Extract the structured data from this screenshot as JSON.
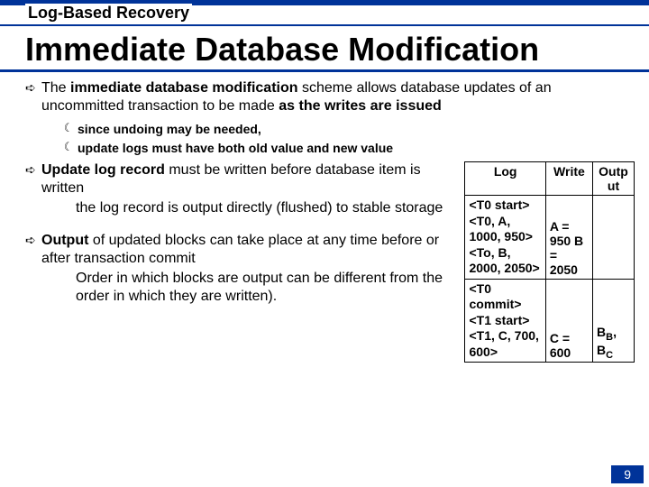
{
  "pretitle": "Log-Based Recovery",
  "title": "Immediate Database Modification",
  "bullets": {
    "b1_pre": "The ",
    "b1_bold1": "immediate database modification",
    "b1_mid": " scheme allows database updates of an uncommitted transaction to be made ",
    "b1_bold2": "as the writes are issued",
    "s1": "since undoing may be needed,",
    "s2": "update logs must have both old value and new value",
    "b2_bold": "Update log record",
    "b2_rest": " must be written before database item is written",
    "b2_sub": "the log record is output directly (flushed) to stable storage",
    "b3_bold": "Output",
    "b3_rest": " of updated blocks can take place at any time before or  after transaction commit",
    "b3_sub": "Order in which blocks are output can be different from the order in which they are written)."
  },
  "table": {
    "h1": "Log",
    "h2": "Write",
    "h3": "Outp ut",
    "r1_log_l1": "<T0 start>",
    "r1_log_l2": "<T0, A, 1000, 950>",
    "r1_log_l3": "<To, B, 2000, 2050>",
    "r1_write": "A = 950 B = 2050",
    "r2_log_l1": "<T0 commit>",
    "r2_log_l2": "<T1 start>",
    "r2_log_l3": "<T1, C, 700, 600>",
    "r2_write": "C = 600",
    "r2_out_pre": "B",
    "r2_out_s1": "B",
    "r2_out_mid": ", B",
    "r2_out_s2": "C"
  },
  "pagenum": "9"
}
